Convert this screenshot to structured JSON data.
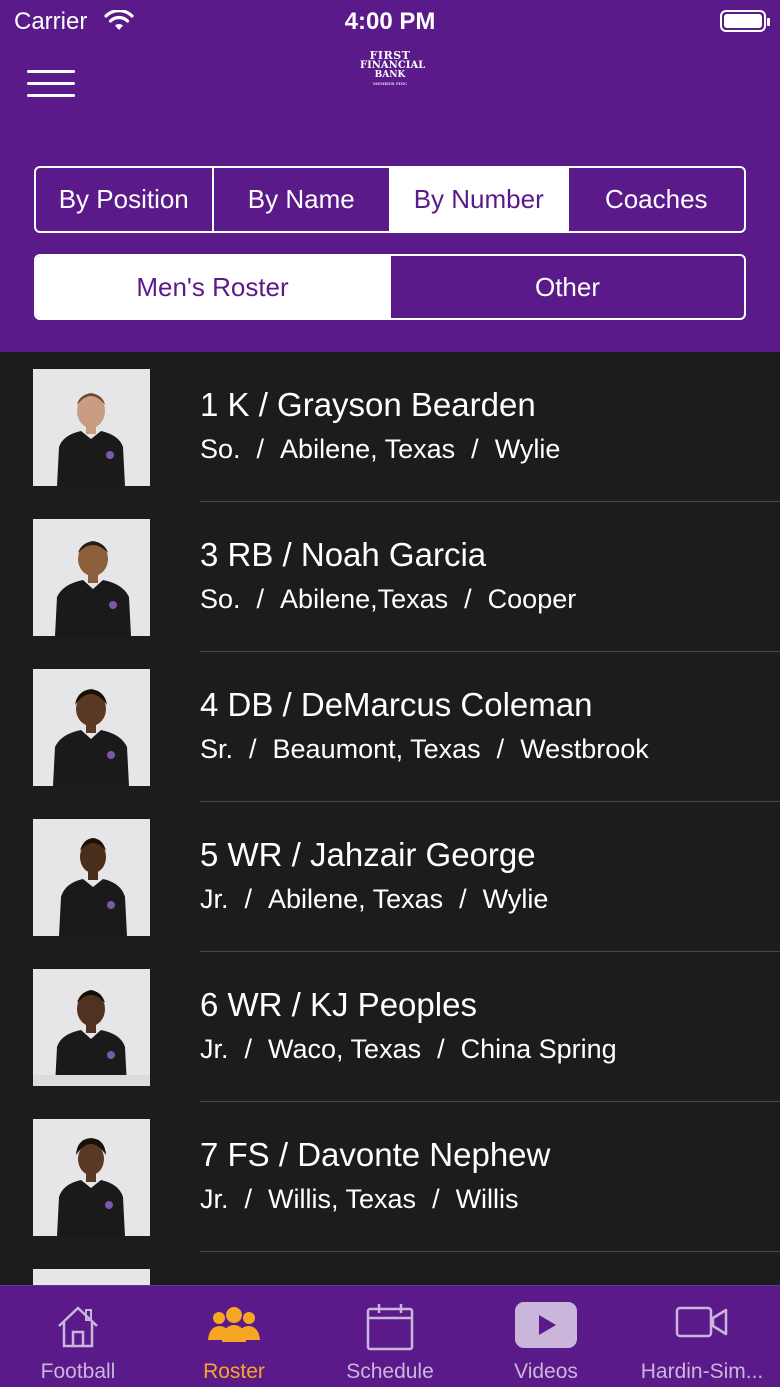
{
  "status": {
    "carrier": "Carrier",
    "time": "4:00 PM"
  },
  "header": {
    "logo": {
      "line1": "FIRST",
      "line2": "FINANCIAL",
      "line3": "BANK",
      "line4": "MEMBER FDIC"
    }
  },
  "filter_tabs": [
    {
      "label": "By Position",
      "selected": false
    },
    {
      "label": "By Name",
      "selected": false
    },
    {
      "label": "By Number",
      "selected": true
    },
    {
      "label": "Coaches",
      "selected": false
    }
  ],
  "roster_tabs": [
    {
      "label": "Men's Roster",
      "selected": true
    },
    {
      "label": "Other",
      "selected": false
    }
  ],
  "players": [
    {
      "title": "1 K / Grayson Bearden",
      "year": "So.",
      "hometown": "Abilene, Texas",
      "school": "Wylie"
    },
    {
      "title": "3 RB / Noah Garcia",
      "year": "So.",
      "hometown": "Abilene,Texas",
      "school": "Cooper"
    },
    {
      "title": "4 DB / DeMarcus Coleman",
      "year": "Sr.",
      "hometown": "Beaumont, Texas",
      "school": "Westbrook"
    },
    {
      "title": "5 WR / Jahzair George",
      "year": "Jr.",
      "hometown": "Abilene, Texas",
      "school": "Wylie"
    },
    {
      "title": "6 WR / KJ Peoples",
      "year": "Jr.",
      "hometown": "Waco, Texas",
      "school": "China Spring"
    },
    {
      "title": "7 FS / Davonte Nephew",
      "year": "Jr.",
      "hometown": "Willis, Texas",
      "school": "Willis"
    }
  ],
  "separator": "/",
  "tabbar": [
    {
      "label": "Football",
      "icon": "home-icon",
      "active": false
    },
    {
      "label": "Roster",
      "icon": "people-icon",
      "active": true
    },
    {
      "label": "Schedule",
      "icon": "calendar-icon",
      "active": false
    },
    {
      "label": "Videos",
      "icon": "youtube-icon",
      "active": false
    },
    {
      "label": "Hardin-Sim...",
      "icon": "video-camera-icon",
      "active": false
    }
  ],
  "colors": {
    "brand_purple": "#5b1a8a",
    "list_background": "#1c1c1e",
    "active_tab": "#f5a623",
    "inactive_tab": "#c9b6da"
  }
}
